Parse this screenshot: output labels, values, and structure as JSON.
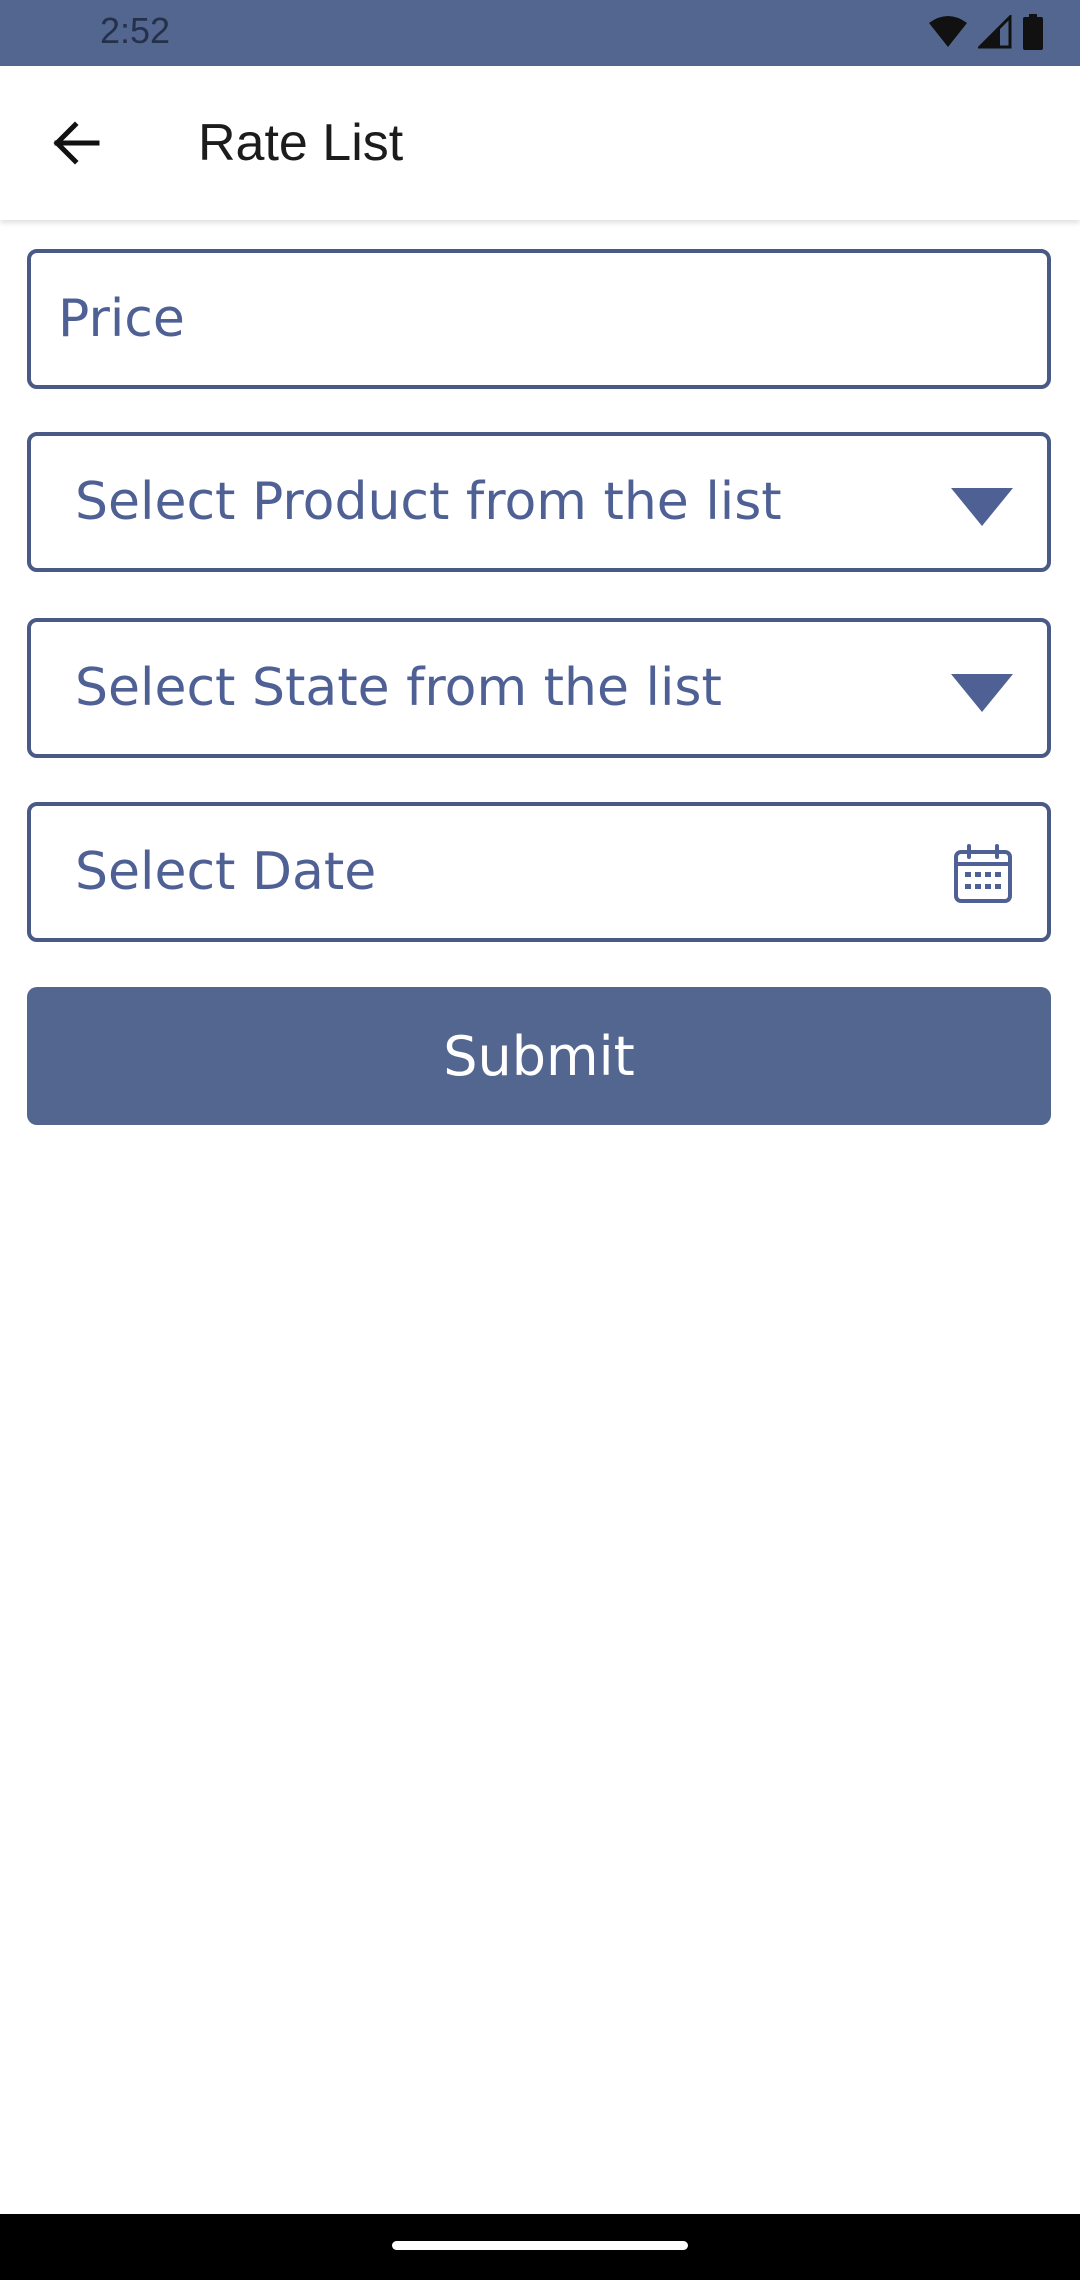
{
  "status_bar": {
    "time": "2:52",
    "icons": [
      "wifi-icon",
      "cellular-signal-icon",
      "battery-icon"
    ]
  },
  "app_bar": {
    "title": "Rate List",
    "back_icon": "arrow-back-icon"
  },
  "form": {
    "price": {
      "placeholder": "Price"
    },
    "product": {
      "label": "Select Product from the list",
      "icon": "dropdown-arrow-icon"
    },
    "state": {
      "label": "Select State from the list",
      "icon": "dropdown-arrow-icon"
    },
    "date": {
      "label": "Select Date",
      "icon": "calendar-icon"
    },
    "submit_label": "Submit"
  },
  "colors": {
    "primary": "#53668f",
    "field_border": "#4a5a86",
    "field_text": "#4f6095",
    "background": "#ffffff"
  }
}
